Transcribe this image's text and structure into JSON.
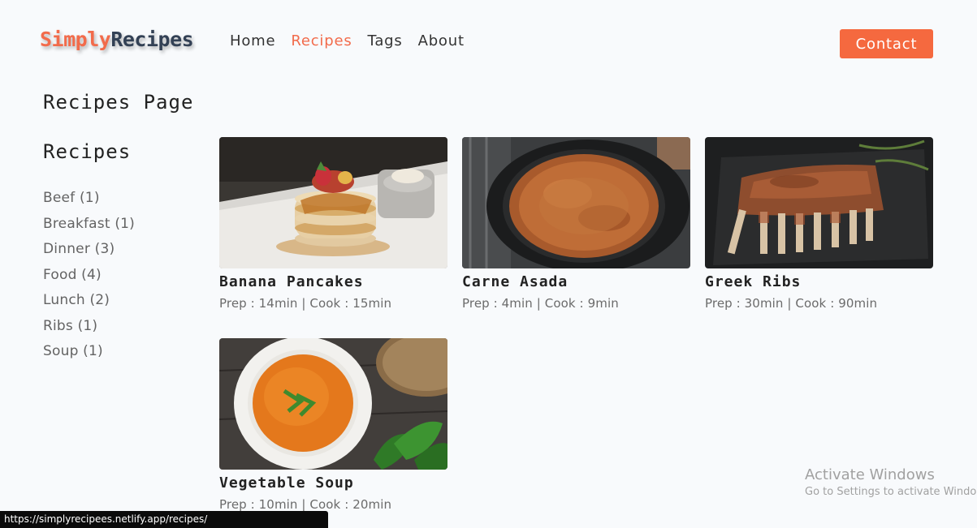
{
  "logo": {
    "part1": "Simply",
    "part2": "Recipes"
  },
  "nav": {
    "links": [
      {
        "label": "Home",
        "active": false
      },
      {
        "label": "Recipes",
        "active": true
      },
      {
        "label": "Tags",
        "active": false
      },
      {
        "label": "About",
        "active": false
      }
    ],
    "contact_label": "Contact"
  },
  "page": {
    "title": "Recipes Page"
  },
  "sidebar": {
    "title": "Recipes",
    "tags": [
      {
        "label": "Beef (1)"
      },
      {
        "label": "Breakfast (1)"
      },
      {
        "label": "Dinner (3)"
      },
      {
        "label": "Food (4)"
      },
      {
        "label": "Lunch (2)"
      },
      {
        "label": "Ribs (1)"
      },
      {
        "label": "Soup (1)"
      }
    ]
  },
  "recipes": [
    {
      "name": "Banana Pancakes",
      "meta": "Prep : 14min | Cook : 15min",
      "image": "banana-pancakes-image"
    },
    {
      "name": "Carne Asada",
      "meta": "Prep : 4min | Cook : 9min",
      "image": "carne-asada-image"
    },
    {
      "name": "Greek Ribs",
      "meta": "Prep : 30min | Cook : 90min",
      "image": "greek-ribs-image"
    },
    {
      "name": "Vegetable Soup",
      "meta": "Prep : 10min | Cook : 20min",
      "image": "vegetable-soup-image"
    }
  ],
  "windows_watermark": {
    "line1": "Activate Windows",
    "line2": "Go to Settings to activate Windows."
  },
  "status_bar": {
    "url": "https://simplyrecipees.netlify.app/recipes/"
  },
  "colors": {
    "accent": "#f26b4b",
    "button": "#f5693f",
    "background": "#f8fafc"
  }
}
